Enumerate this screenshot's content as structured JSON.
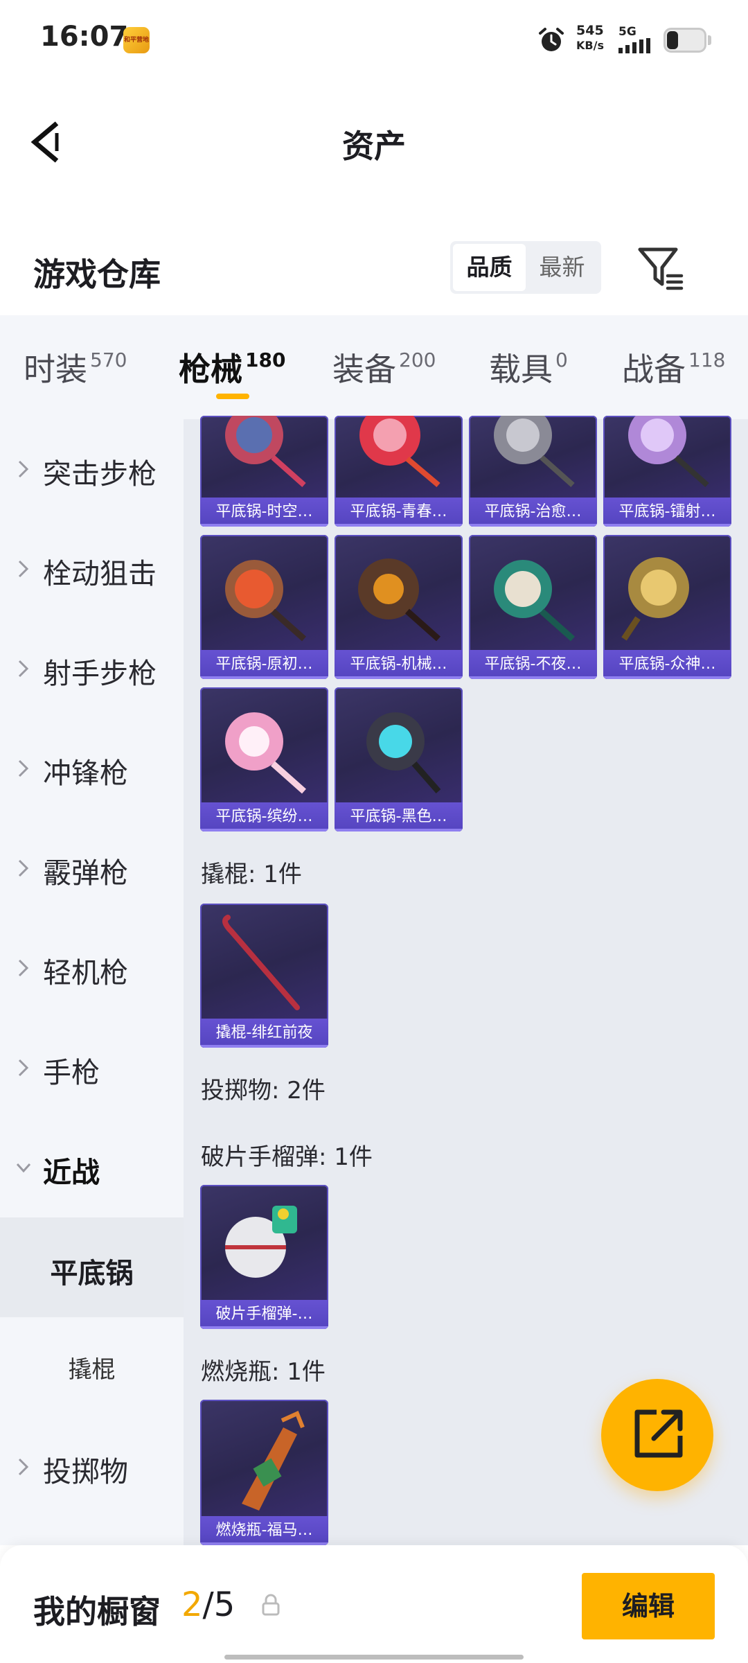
{
  "status_bar": {
    "time": "16:07",
    "app_badge_text": "和平营地",
    "net_speed_value": "545",
    "net_speed_unit": "KB/s",
    "net_type": "5G",
    "icons": [
      "alarm-icon",
      "signal-icon",
      "battery-icon"
    ]
  },
  "header": {
    "title": "资产",
    "back_icon": "chevron-left-icon"
  },
  "warehouse": {
    "title": "游戏仓库",
    "sort_options": [
      "品质",
      "最新"
    ],
    "sort_selected": "品质",
    "filter_icon": "filter-icon"
  },
  "tabs": [
    {
      "label": "时装",
      "count": "570"
    },
    {
      "label": "枪械",
      "count": "180",
      "active": true
    },
    {
      "label": "装备",
      "count": "200"
    },
    {
      "label": "载具",
      "count": "0"
    },
    {
      "label": "战备",
      "count": "118"
    }
  ],
  "sidebar": {
    "items": [
      {
        "label": "突击步枪"
      },
      {
        "label": "栓动狙击"
      },
      {
        "label": "射手步枪"
      },
      {
        "label": "冲锋枪"
      },
      {
        "label": "霰弹枪"
      },
      {
        "label": "轻机枪"
      },
      {
        "label": "手枪"
      },
      {
        "label": "近战",
        "expanded": true
      },
      {
        "label": "平底锅",
        "sub": true,
        "active": true
      },
      {
        "label": "撬棍",
        "sub": true
      },
      {
        "label": "投掷物"
      }
    ]
  },
  "content": {
    "pan_cards": [
      "平底锅-时空…",
      "平底锅-青春…",
      "平底锅-治愈…",
      "平底锅-镭射…",
      "平底锅-原初…",
      "平底锅-机械…",
      "平底锅-不夜…",
      "平底锅-众神…",
      "平底锅-缤纷…",
      "平底锅-黑色…"
    ],
    "crowbar_section": "撬棍: 1件",
    "crowbar_cards": [
      "撬棍-绯红前夜"
    ],
    "throwable_section": "投掷物: 2件",
    "grenade_section": "破片手榴弹: 1件",
    "grenade_cards": [
      "破片手榴弹-…"
    ],
    "molotov_section": "燃烧瓶: 1件",
    "molotov_cards": [
      "燃烧瓶-福马…"
    ]
  },
  "fab": {
    "icon": "share-icon"
  },
  "showcase": {
    "label": "我的橱窗",
    "current": "2",
    "separator": "/",
    "total": "5",
    "lock_icon": "lock-icon",
    "edit_label": "编辑"
  },
  "colors": {
    "accent": "#ffb300",
    "card_bg": "#2c2750",
    "card_label": "#5444bf",
    "page_bg": "#e8ebf1"
  }
}
